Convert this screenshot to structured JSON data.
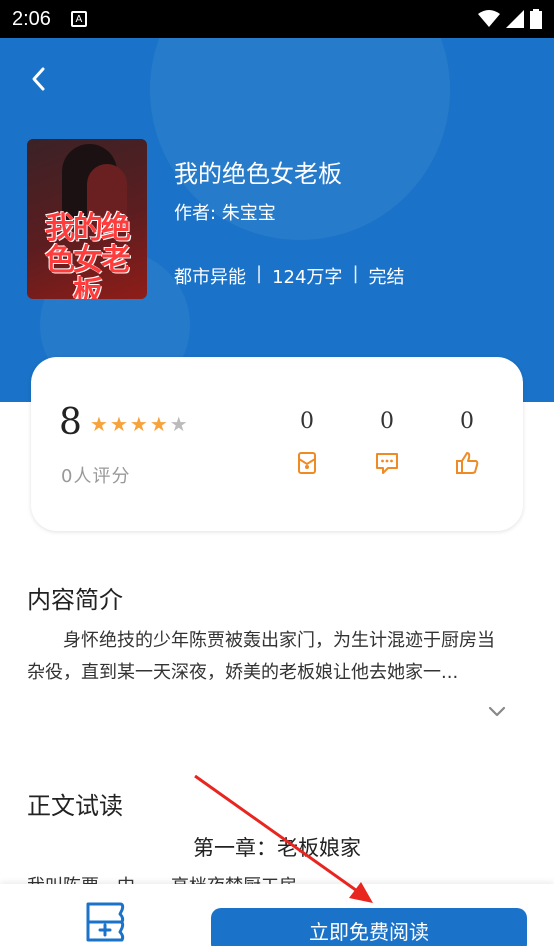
{
  "status_bar": {
    "time": "2:06",
    "notification_glyph": "A"
  },
  "header": {
    "back_icon": "chevron-left-icon"
  },
  "book": {
    "cover_text": "我的绝色女老板",
    "title": "我的绝色女老板",
    "author": "作者: 朱宝宝",
    "category": "都市异能",
    "word_count": "124万字",
    "status": "完结",
    "separator": "|"
  },
  "rating": {
    "score": "8",
    "stars_filled": 4,
    "stars_total": 5,
    "count_text": "0人评分",
    "stats": [
      {
        "value": "0",
        "icon": "gift-icon"
      },
      {
        "value": "0",
        "icon": "comment-icon"
      },
      {
        "value": "0",
        "icon": "thumbs-up-icon"
      }
    ]
  },
  "intro": {
    "heading": "内容简介",
    "text": "身怀绝技的少年陈贾被轰出家门，为生计混迹于厨房当杂役，直到某一天深夜，娇美的老板娘让他去她家一..."
  },
  "trial": {
    "heading": "正文试读",
    "chapter_title": "第一章：老板娘家",
    "chapter_preview": "我叫陈贾，中一，高档夜梦厨工房，"
  },
  "bottom": {
    "shelf_icon": "add-to-shelf-icon",
    "read_button": "立即免费阅读"
  },
  "colors": {
    "primary": "#1a73c8",
    "star": "#f7a23b",
    "icon_orange": "#f08a24",
    "arrow": "#e8251f"
  }
}
